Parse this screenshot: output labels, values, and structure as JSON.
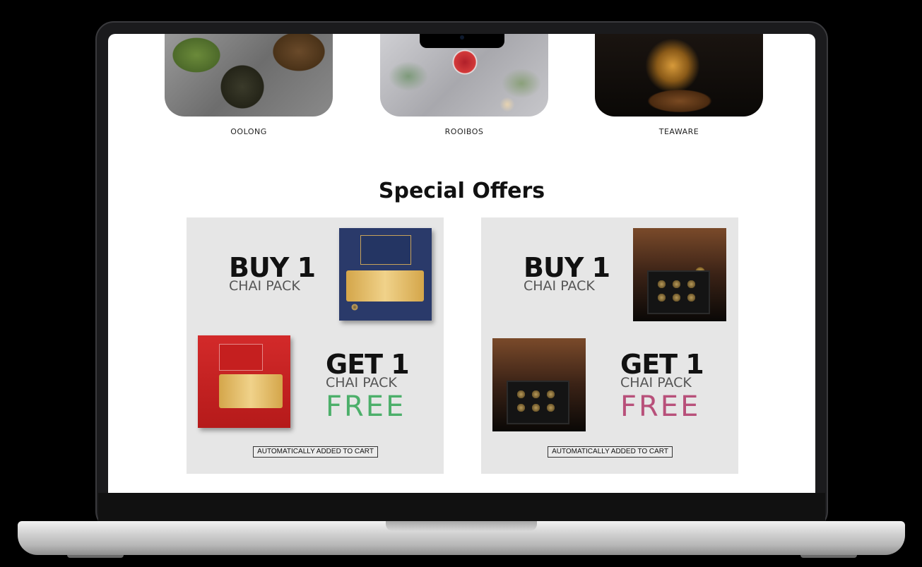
{
  "categories": [
    {
      "label": "OOLONG"
    },
    {
      "label": "ROOIBOS"
    },
    {
      "label": "TEAWARE"
    }
  ],
  "section_title": "Special Offers",
  "offers": [
    {
      "buy_title": "BUY 1",
      "buy_sub": "CHAI PACK",
      "get_title": "GET 1",
      "get_sub": "CHAI PACK",
      "free_label": "FREE",
      "free_color": "#4caf6a",
      "badge": "AUTOMATICALLY ADDED TO CART"
    },
    {
      "buy_title": "BUY 1",
      "buy_sub": "CHAI PACK",
      "get_title": "GET 1",
      "get_sub": "CHAI PACK",
      "free_label": "FREE",
      "free_color": "#b8507a",
      "badge": "AUTOMATICALLY ADDED TO CART"
    }
  ]
}
